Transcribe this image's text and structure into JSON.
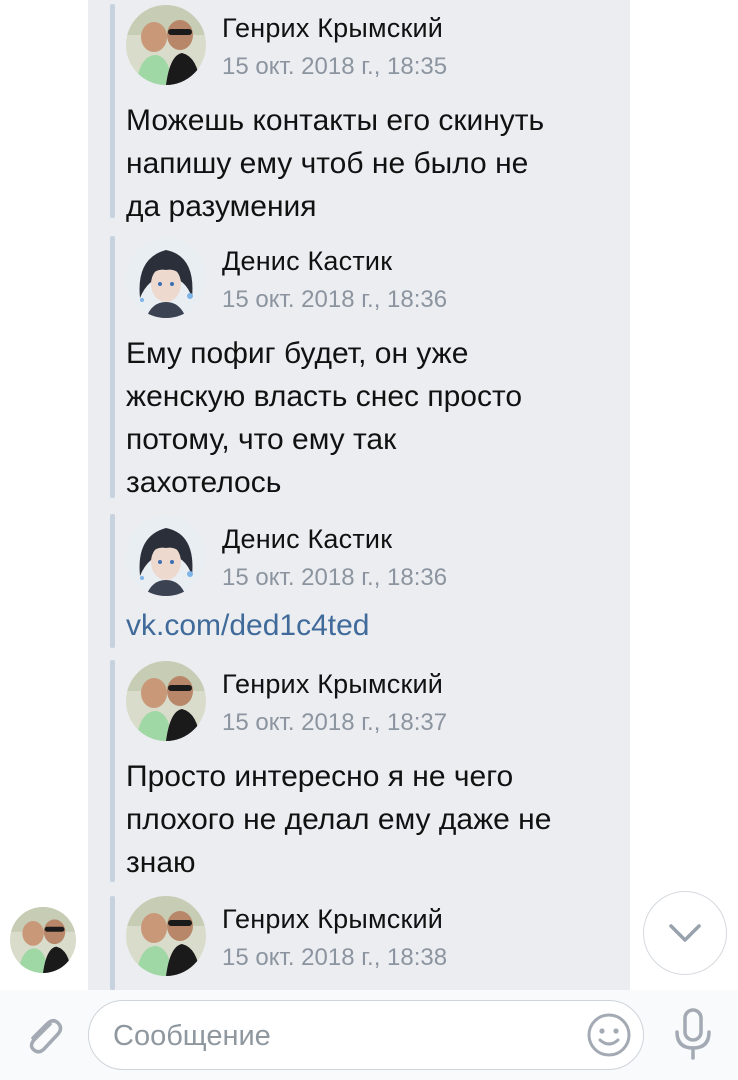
{
  "messages": [
    {
      "author": "Генрих Крымский",
      "date": "15 окт. 2018 г., 18:35",
      "text": "Можешь контакты его скинуть\nнапишу ему чтоб не было не\nда разумения",
      "avatar": "henry-avatar"
    },
    {
      "author": "Денис Кастик",
      "date": "15 окт. 2018 г., 18:36",
      "text": "Ему пофиг будет, он уже\nженскую власть снес просто\nпотому, что ему так\nзахотелось",
      "avatar": "denis-avatar"
    },
    {
      "author": "Денис Кастик",
      "date": "15 окт. 2018 г., 18:36",
      "link": "vk.com/ded1c4ted",
      "avatar": "denis-avatar"
    },
    {
      "author": "Генрих Крымский",
      "date": "15 окт. 2018 г., 18:37",
      "text": "Просто интересно я не чего\nплохого не делал ему даже не\nзнаю",
      "avatar": "henry-avatar"
    },
    {
      "author": "Генрих Крымский",
      "date": "15 окт. 2018 г., 18:38",
      "avatar": "henry-avatar"
    }
  ],
  "composer": {
    "placeholder": "Сообщение",
    "icons": [
      "paperclip-icon",
      "smile-icon",
      "microphone-icon"
    ]
  },
  "scroll_button_icon": "chevron-down-icon",
  "colors": {
    "bubble_bg": "#ebedf1",
    "forward_line": "#c7d2df",
    "link": "#3f6a99",
    "date_text": "#8c959f",
    "icon_gray": "#a3aab3"
  }
}
